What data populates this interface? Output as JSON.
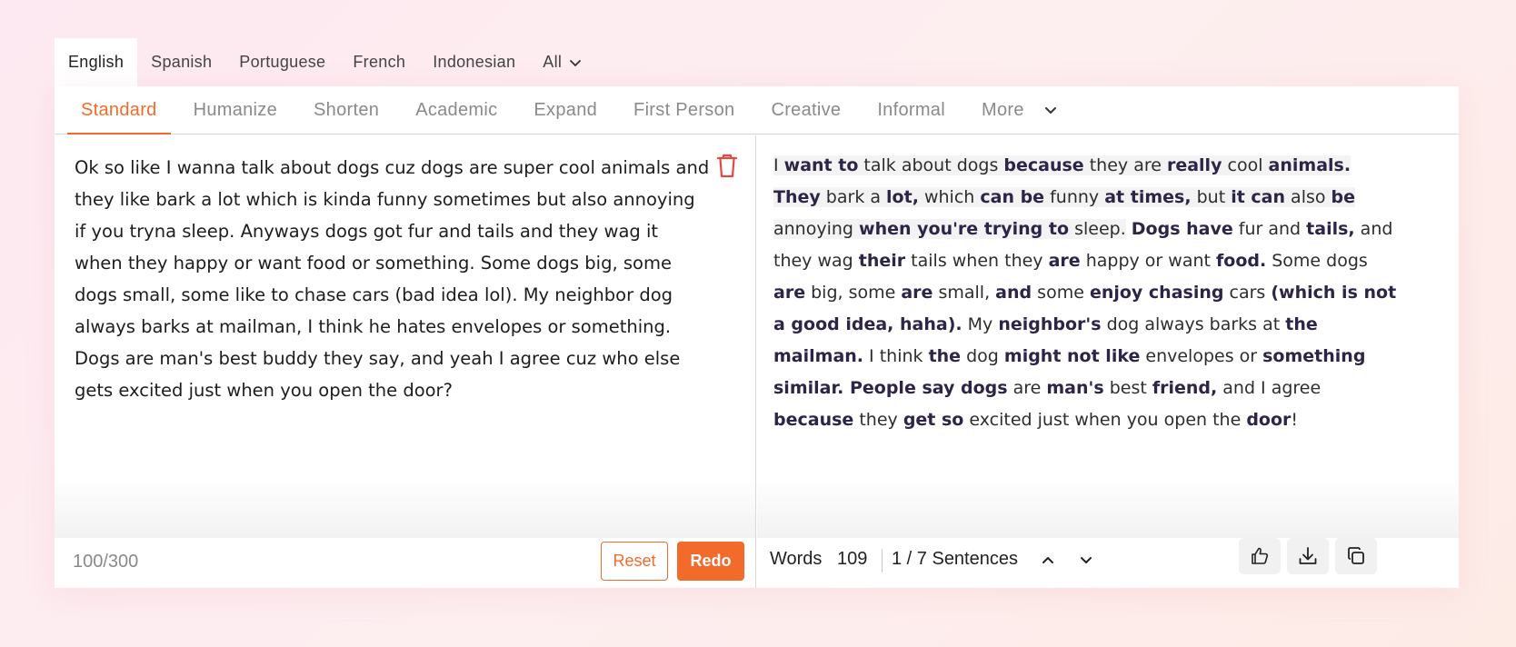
{
  "languages": {
    "items": [
      "English",
      "Spanish",
      "Portuguese",
      "French",
      "Indonesian"
    ],
    "all_label": "All",
    "active": "English"
  },
  "modes": {
    "items": [
      "Standard",
      "Humanize",
      "Shorten",
      "Academic",
      "Expand",
      "First Person",
      "Creative",
      "Informal"
    ],
    "more_label": "More",
    "active": "Standard"
  },
  "input": {
    "text": "Ok so like I wanna talk about dogs cuz dogs are super cool animals and they like bark a lot which is kinda funny sometimes but also annoying if you tryna sleep. Anyways dogs got fur and tails and they wag it when they happy or want food or something. Some dogs big, some dogs small, some like to chase cars (bad idea lol). My neighbor dog always barks at mailman, I think he hates envelopes or something. Dogs are man's best buddy they say, and yeah I agree cuz who else gets excited just when you open the door?",
    "counter": "100/300",
    "reset_label": "Reset",
    "redo_label": "Redo"
  },
  "output": {
    "segments": [
      {
        "t": "I ",
        "b": false,
        "hl": true
      },
      {
        "t": "want to",
        "b": true,
        "hl": true
      },
      {
        "t": " talk about dogs ",
        "b": false,
        "hl": true
      },
      {
        "t": "because",
        "b": true,
        "hl": true
      },
      {
        "t": " they are ",
        "b": false,
        "hl": true
      },
      {
        "t": "really",
        "b": true,
        "hl": true
      },
      {
        "t": " cool ",
        "b": false,
        "hl": true
      },
      {
        "t": "animals. They",
        "b": true,
        "hl": true
      },
      {
        "t": " bark a ",
        "b": false,
        "hl": true
      },
      {
        "t": "lot,",
        "b": true,
        "hl": true
      },
      {
        "t": " which ",
        "b": false,
        "hl": true
      },
      {
        "t": "can be",
        "b": true,
        "hl": true
      },
      {
        "t": " funny ",
        "b": false,
        "hl": true
      },
      {
        "t": "at times,",
        "b": true,
        "hl": true
      },
      {
        "t": " but ",
        "b": false,
        "hl": true
      },
      {
        "t": "it can",
        "b": true,
        "hl": true
      },
      {
        "t": " also ",
        "b": false,
        "hl": true
      },
      {
        "t": "be",
        "b": true,
        "hl": true
      },
      {
        "t": " annoying ",
        "b": false,
        "hl": true
      },
      {
        "t": "when you're trying to",
        "b": true,
        "hl": true
      },
      {
        "t": " sleep.",
        "b": false,
        "hl": true
      },
      {
        "t": " ",
        "b": false,
        "hl": false
      },
      {
        "t": "Dogs have",
        "b": true,
        "hl": false
      },
      {
        "t": " fur and ",
        "b": false,
        "hl": false
      },
      {
        "t": "tails,",
        "b": true,
        "hl": false
      },
      {
        "t": " and they wag ",
        "b": false,
        "hl": false
      },
      {
        "t": "their",
        "b": true,
        "hl": false
      },
      {
        "t": " tails when they ",
        "b": false,
        "hl": false
      },
      {
        "t": "are",
        "b": true,
        "hl": false
      },
      {
        "t": " happy or want ",
        "b": false,
        "hl": false
      },
      {
        "t": "food.",
        "b": true,
        "hl": false
      },
      {
        "t": " Some dogs ",
        "b": false,
        "hl": false
      },
      {
        "t": "are",
        "b": true,
        "hl": false
      },
      {
        "t": " big, some ",
        "b": false,
        "hl": false
      },
      {
        "t": "are",
        "b": true,
        "hl": false
      },
      {
        "t": " small, ",
        "b": false,
        "hl": false
      },
      {
        "t": "and",
        "b": true,
        "hl": false
      },
      {
        "t": " some ",
        "b": false,
        "hl": false
      },
      {
        "t": "enjoy chasing",
        "b": true,
        "hl": false
      },
      {
        "t": " cars ",
        "b": false,
        "hl": false
      },
      {
        "t": "(which is not a good idea, haha).",
        "b": true,
        "hl": false
      },
      {
        "t": " My ",
        "b": false,
        "hl": false
      },
      {
        "t": "neighbor's",
        "b": true,
        "hl": false
      },
      {
        "t": " dog always barks at ",
        "b": false,
        "hl": false
      },
      {
        "t": "the mailman.",
        "b": true,
        "hl": false
      },
      {
        "t": " I think ",
        "b": false,
        "hl": false
      },
      {
        "t": "the",
        "b": true,
        "hl": false
      },
      {
        "t": " dog ",
        "b": false,
        "hl": false
      },
      {
        "t": "might not like",
        "b": true,
        "hl": false
      },
      {
        "t": " envelopes or ",
        "b": false,
        "hl": false
      },
      {
        "t": "something similar. People say dogs",
        "b": true,
        "hl": false
      },
      {
        "t": " are ",
        "b": false,
        "hl": false
      },
      {
        "t": "man's",
        "b": true,
        "hl": false
      },
      {
        "t": " best ",
        "b": false,
        "hl": false
      },
      {
        "t": "friend,",
        "b": true,
        "hl": false
      },
      {
        "t": " and I agree ",
        "b": false,
        "hl": false
      },
      {
        "t": "because",
        "b": true,
        "hl": false
      },
      {
        "t": " they ",
        "b": false,
        "hl": false
      },
      {
        "t": "get so",
        "b": true,
        "hl": false
      },
      {
        "t": " excited just when you open the ",
        "b": false,
        "hl": false
      },
      {
        "t": "door",
        "b": true,
        "hl": false
      },
      {
        "t": "!",
        "b": false,
        "hl": false
      }
    ],
    "words_label": "Words",
    "words_count": "109",
    "sentences_label": "1 / 7 Sentences"
  },
  "icons": {
    "trash": "trash-icon",
    "thumbs_up": "thumbs-up-icon",
    "download": "download-icon",
    "copy": "copy-icon",
    "chevron_up": "chevron-up-icon",
    "chevron_down": "chevron-down-icon"
  },
  "colors": {
    "accent": "#f26b2b",
    "bold_text": "#2e2448",
    "trash": "#e8473f"
  }
}
